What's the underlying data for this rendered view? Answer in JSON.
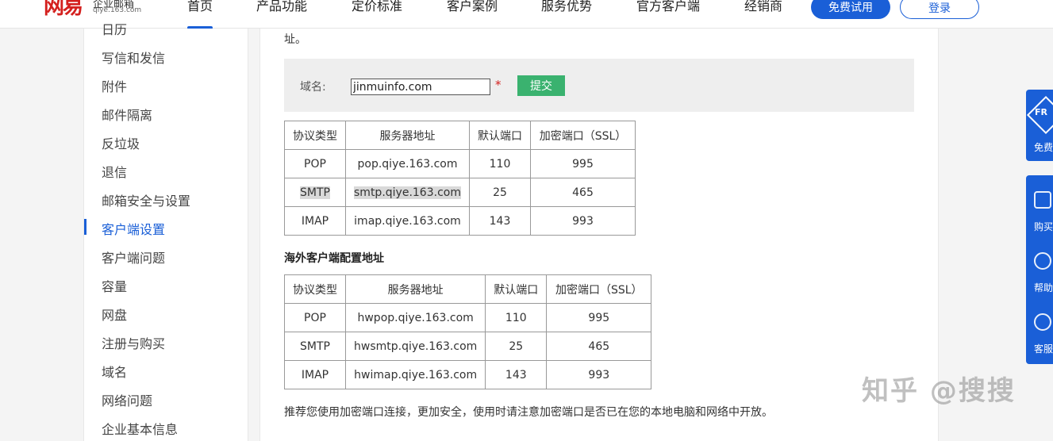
{
  "brand": {
    "logo_text": "网易",
    "logo_sub": "企业邮箱",
    "logo_url_text": "qiye.163.com"
  },
  "nav": {
    "items": [
      "首页",
      "产品功能",
      "定价标准",
      "客户案例",
      "服务优势",
      "官方客户端",
      "经销商"
    ],
    "trial_button": "免费试用",
    "login_button": "登录"
  },
  "sidebar": {
    "items": [
      "日历",
      "写信和发信",
      "附件",
      "邮件隔离",
      "反垃圾",
      "退信",
      "邮箱安全与设置",
      "客户端设置",
      "客户端问题",
      "容量",
      "网盘",
      "注册与购买",
      "域名",
      "网络问题",
      "企业基本信息"
    ],
    "active_index": 7
  },
  "content": {
    "fragment_text": "址。",
    "domain_label": "域名:",
    "domain_value": "jinmuinfo.com",
    "required_mark": "*",
    "submit_label": "提交",
    "table1": {
      "headers": [
        "协议类型",
        "服务器地址",
        "默认端口",
        "加密端口（SSL）"
      ],
      "rows": [
        [
          "POP",
          "pop.qiye.163.com",
          "110",
          "995"
        ],
        [
          "SMTP",
          "smtp.qiye.163.com",
          "25",
          "465"
        ],
        [
          "IMAP",
          "imap.qiye.163.com",
          "143",
          "993"
        ]
      ]
    },
    "overseas_title": "海外客户端配置地址",
    "table2": {
      "headers": [
        "协议类型",
        "服务器地址",
        "默认端口",
        "加密端口（SSL）"
      ],
      "rows": [
        [
          "POP",
          "hwpop.qiye.163.com",
          "110",
          "995"
        ],
        [
          "SMTP",
          "hwsmtp.qiye.163.com",
          "25",
          "465"
        ],
        [
          "IMAP",
          "hwimap.qiye.163.com",
          "143",
          "993"
        ]
      ]
    },
    "tip": "推荐您使用加密端口连接，更加安全，使用时请注意加密端口是否已在您的本地电脑和网络中开放。"
  },
  "floating": {
    "badge_text": "FR",
    "free_label": "免费",
    "buy_label": "购买",
    "help_label": "帮助",
    "service_label": "客服"
  },
  "watermark": "知乎 @搜搜",
  "colors": {
    "brand_red": "#d4201e",
    "accent_blue": "#1a5fd7",
    "submit_green": "#3ab26f"
  }
}
